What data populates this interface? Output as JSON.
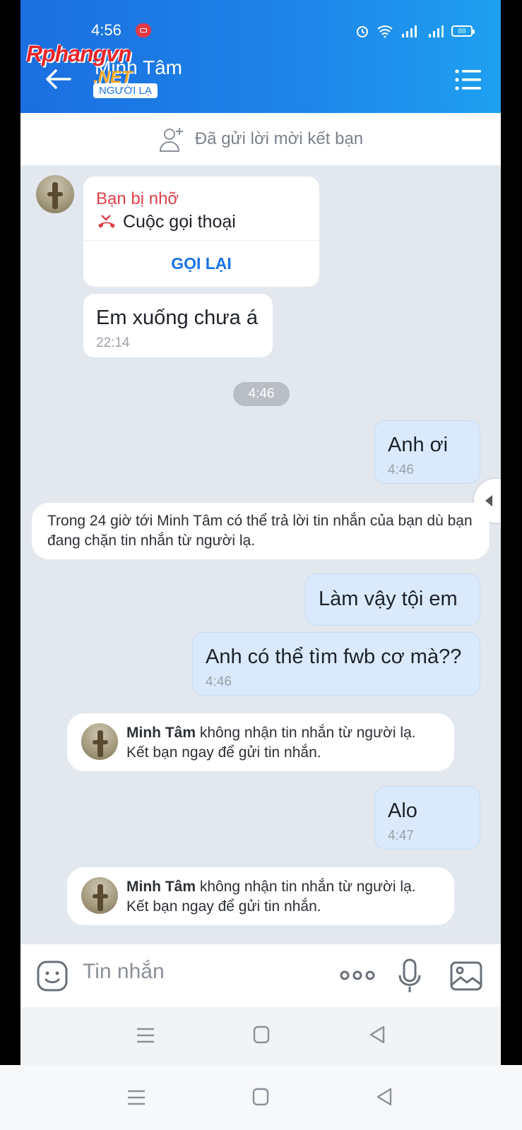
{
  "status_bar": {
    "time": "4:56",
    "battery": "88"
  },
  "watermark": {
    "main": "Rphangvn",
    "sub": ".NET"
  },
  "header": {
    "contact_name": "Minh Tâm",
    "stranger_badge": "NGƯỜI LẠ"
  },
  "friend_request": {
    "text": "Đã gửi lời mời kết bạn"
  },
  "missed_call": {
    "title": "Bạn bị nhỡ",
    "type": "Cuộc gọi thoại",
    "call_back": "GỌI LẠI"
  },
  "messages": [
    {
      "text": "Em xuống chưa á",
      "time": "22:14",
      "direction": "in"
    },
    {
      "text": "Anh ơi",
      "time": "4:46",
      "direction": "out"
    },
    {
      "text": "Làm vậy tội em",
      "direction": "out"
    },
    {
      "text": "Anh có thể tìm fwb cơ mà??",
      "time": "4:46",
      "direction": "out"
    },
    {
      "text": "Alo",
      "time": "4:47",
      "direction": "out"
    }
  ],
  "time_divider": "4:46",
  "notices": {
    "reply_window": "Trong 24 giờ tới Minh Tâm có thể trả lời tin nhắn của bạn dù bạn đang chặn tin nhắn từ người lạ.",
    "blocked_name": "Minh Tâm",
    "blocked_line1": " không nhận tin nhắn từ người lạ.",
    "blocked_line2": "Kết bạn ngay để gửi tin nhắn."
  },
  "input": {
    "placeholder": "Tin nhắn"
  },
  "colors": {
    "header_blue": "#1e86ea",
    "accent_blue": "#1a73e8",
    "missed_red": "#e0414a",
    "outgoing_bubble": "#daeafc",
    "chat_bg": "#e3e8ef"
  },
  "icons": [
    "back-arrow-icon",
    "menu-list-icon",
    "add-friend-icon",
    "missed-call-icon",
    "emoji-icon",
    "more-dots-icon",
    "microphone-icon",
    "image-icon",
    "alarm-icon",
    "wifi-icon",
    "signal-icon",
    "battery-icon",
    "recording-icon"
  ]
}
